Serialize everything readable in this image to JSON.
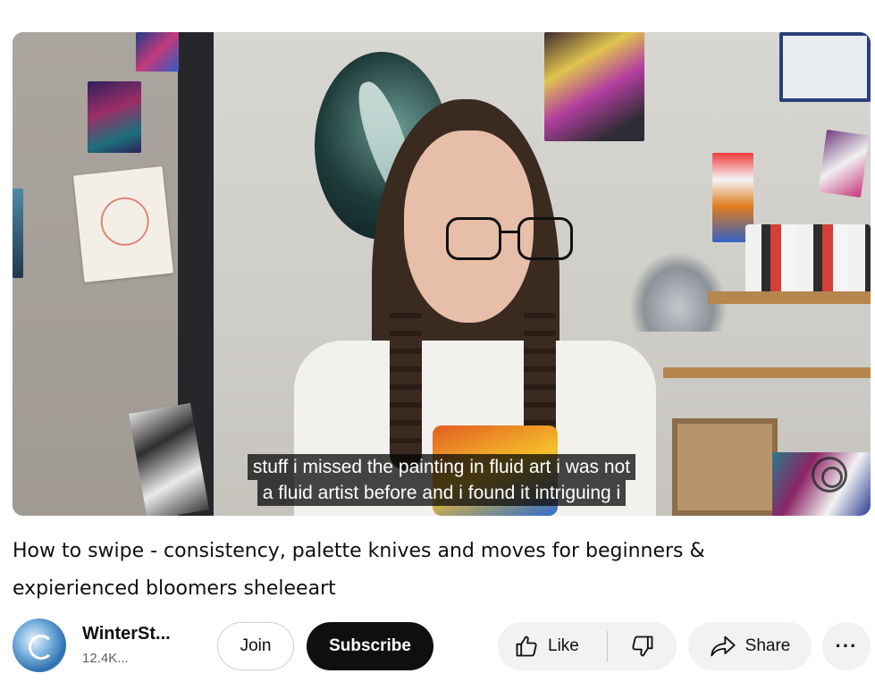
{
  "video": {
    "captions": [
      "stuff i missed the painting in fluid art i was not",
      "a fluid artist before and i found it intriguing i"
    ]
  },
  "title": "How to swipe - consistency, palette knives and moves for beginners & expierienced bloomers sheleeart",
  "channel": {
    "name": "WinterSt...",
    "subscribers": "12.4K...",
    "avatar_icon": "avatar-icon"
  },
  "actions": {
    "join_label": "Join",
    "subscribe_label": "Subscribe",
    "like_label": "Like",
    "like_icon": "thumbs-up-icon",
    "dislike_icon": "thumbs-down-icon",
    "share_label": "Share",
    "share_icon": "share-arrow-icon",
    "more_label": "···",
    "more_icon": "more-icon"
  },
  "colors": {
    "subscribe_bg": "#0f0f0f",
    "pill_bg": "#f2f2f2",
    "caption_bg": "#080808"
  }
}
